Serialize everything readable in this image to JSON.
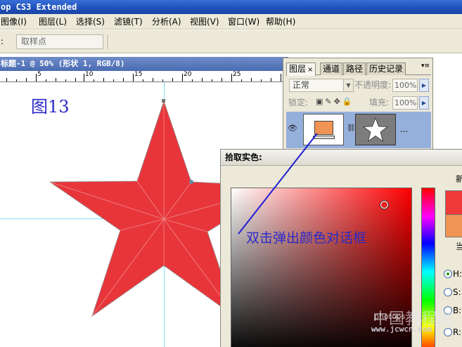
{
  "window": {
    "title": "op CS3 Extended"
  },
  "menu": [
    {
      "label": "图像(I)"
    },
    {
      "label": "图层(L)"
    },
    {
      "label": "选择(S)"
    },
    {
      "label": "滤镜(T)"
    },
    {
      "label": "分析(A)"
    },
    {
      "label": "视图(V)"
    },
    {
      "label": "窗口(W)"
    },
    {
      "label": "帮助(H)"
    }
  ],
  "options": {
    "colon": ":",
    "sample_value": "取样点"
  },
  "document": {
    "title": "标题-1 @ 50% (形状 1, RGB/8)",
    "ruler_numbers": [
      "5",
      "10",
      "15",
      "20",
      "25"
    ],
    "canvas_label": "图13"
  },
  "layers_panel": {
    "tabs": [
      {
        "label": "图层"
      },
      {
        "label": "通道"
      },
      {
        "label": "路径"
      },
      {
        "label": "历史记录"
      }
    ],
    "tab_close": "×",
    "blend_mode": "正常",
    "opacity_label": "不透明度:",
    "opacity_value": "100%",
    "lock_label": "锁定:",
    "fill_label": "填充:",
    "fill_value": "100%",
    "layer_name": "..."
  },
  "color_picker": {
    "title": "拾取实色:",
    "label_new": "新",
    "label_current": "当",
    "modes": [
      {
        "label": "H:",
        "selected": true
      },
      {
        "label": "S:",
        "selected": false
      },
      {
        "label": "B:",
        "selected": false
      },
      {
        "label": "R:",
        "selected": false
      }
    ],
    "new_color": "#ef3a3a",
    "current_color": "#f09455"
  },
  "annotation": {
    "text": "双击弹出颜色对话框"
  },
  "watermark": {
    "site": "www.jcwcn.com",
    "cn": "中国教程网",
    "small": "photops"
  },
  "colors": {
    "star": "#e8353a",
    "guide": "#7fe0ef",
    "annotation": "#2a2ac8",
    "arrow": "#1f1fd0"
  }
}
